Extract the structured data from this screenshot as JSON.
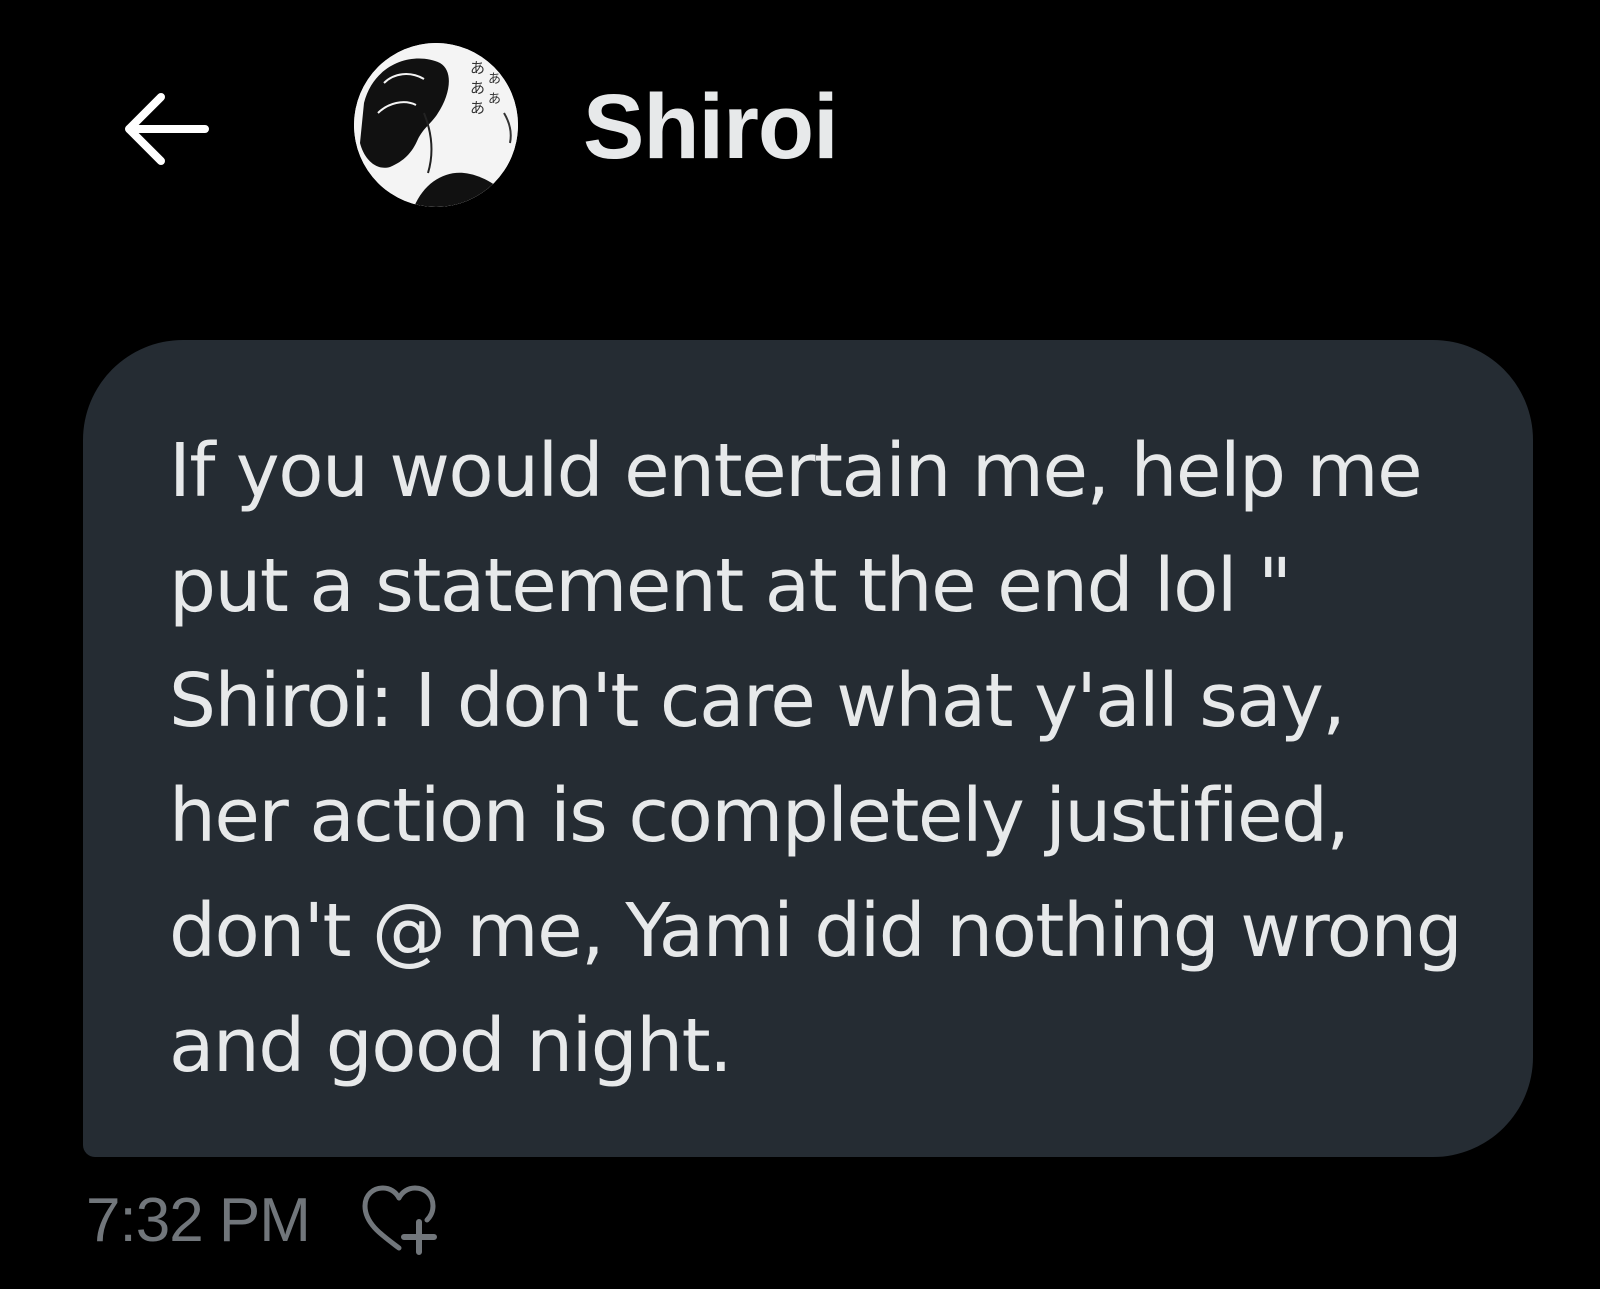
{
  "header": {
    "back_icon": "arrow-left-icon",
    "avatar_icon": "avatar-manga-illustration",
    "avatar_kana": "ああああ",
    "contact_name": "Shiroi"
  },
  "message": {
    "text": "If you would entertain me, help me put a statement at the end lol \" Shiroi: I don't care what y'all say, her action is completely justified, don't @ me, Yami did nothing wrong and good night.",
    "timestamp": "7:32 PM",
    "react_icon": "heart-plus-icon"
  },
  "colors": {
    "background": "#000000",
    "bubble": "#252c33",
    "text": "#e7e9ea",
    "muted": "#71767b"
  }
}
